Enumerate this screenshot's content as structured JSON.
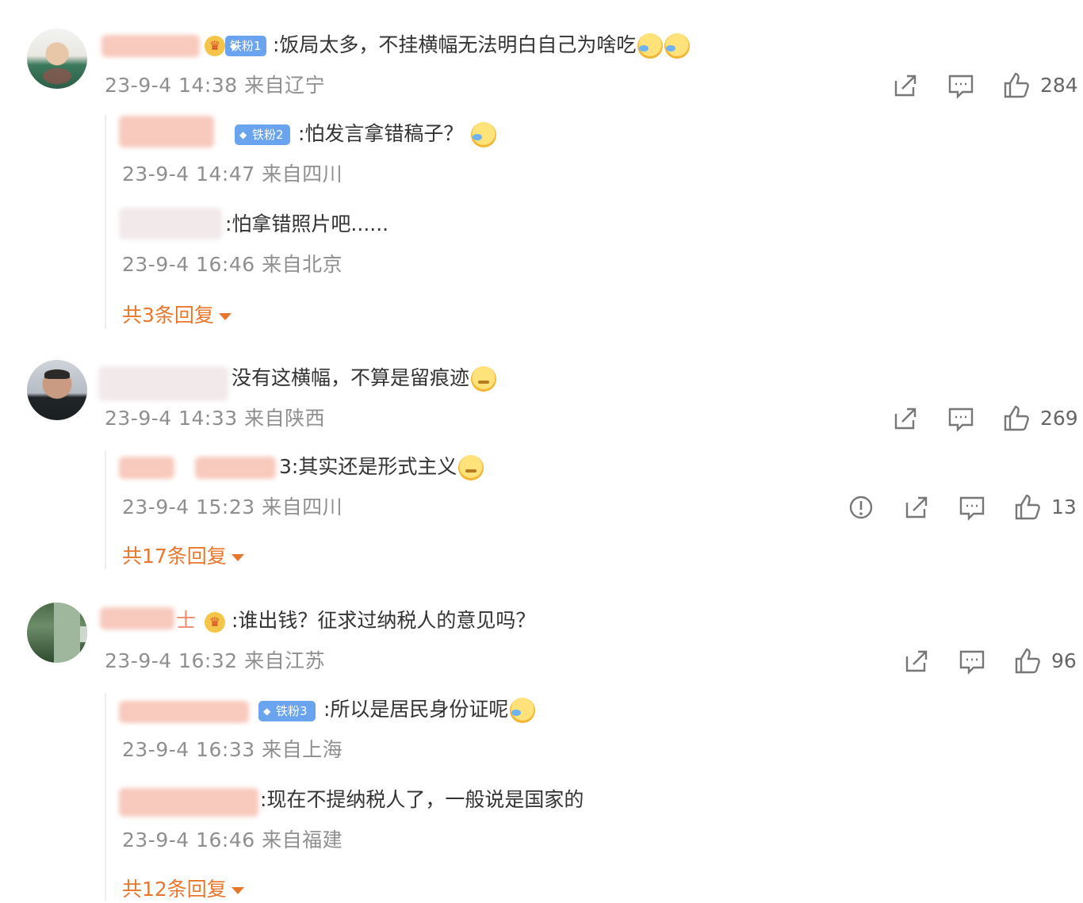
{
  "comments": [
    {
      "name": "",
      "badge": "铁粉1",
      "text": ":饭局太多，不挂横幅无法明白自己为啥吃",
      "meta": "23-9-4 14:38 来自辽宁",
      "likes": "284",
      "replies": [
        {
          "badge": "铁粉2",
          "text": ":怕发言拿错稿子？",
          "meta": "23-9-4 14:47 来自四川"
        },
        {
          "text": ":怕拿错照片吧......",
          "meta": "23-9-4 16:46 来自北京"
        }
      ],
      "more": "共3条回复"
    },
    {
      "name_fragment": "没有这横幅，不算是留痕迹",
      "text": "没有这横幅，不算是留痕迹",
      "meta": "23-9-4 14:33 来自陕西",
      "likes": "269",
      "replies": [
        {
          "text": "3:其实还是形式主义",
          "meta": "23-9-4 15:23 来自四川",
          "likes": "13"
        }
      ],
      "more": "共17条回复"
    },
    {
      "name_tail": "士",
      "text": ":谁出钱？征求过纳税人的意见吗？",
      "meta": "23-9-4 16:32 来自江苏",
      "likes": "96",
      "replies": [
        {
          "badge": "铁粉3",
          "text": ":所以是居民身份证呢",
          "meta": "23-9-4 16:33 来自上海"
        },
        {
          "text": ":现在不提纳税人了，一般说是国家的",
          "meta": "23-9-4 16:46 来自福建"
        }
      ],
      "more": "共12条回复"
    }
  ],
  "icons": [
    "share-icon",
    "comment-icon",
    "like-icon",
    "report-icon"
  ],
  "colors": {
    "more_link": "#e8772d",
    "meta": "#8f8f8f",
    "text": "#333333"
  }
}
